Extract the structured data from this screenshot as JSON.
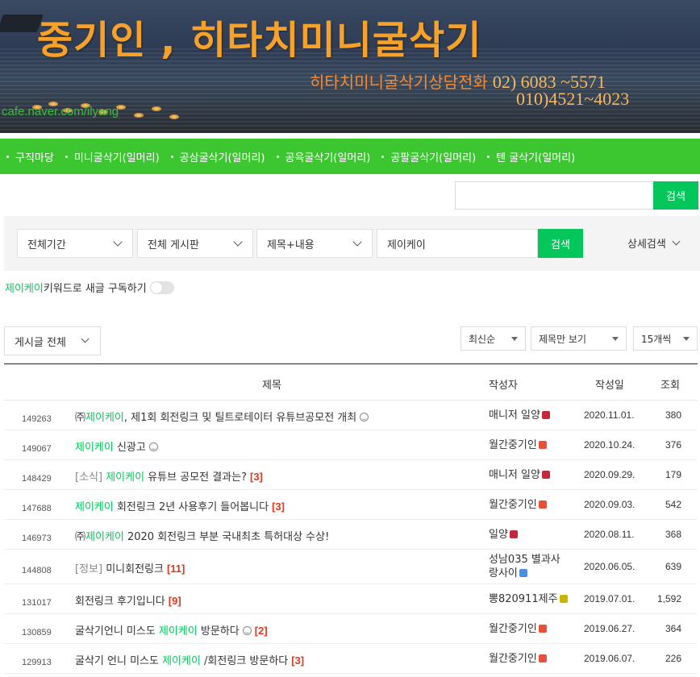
{
  "banner": {
    "title": "중기인 , 히타치미니굴삭기",
    "phone_label": "히타치미니굴삭기상담전화",
    "phone1": "02) 6083 ~5571",
    "phone2": "010)4521~4023",
    "url": "cafe.naver.com/ilyang"
  },
  "nav": {
    "items": [
      "구직마당",
      "미니굴삭기(일머리)",
      "공삼굴삭기(일머리)",
      "공육굴삭기(일머리)",
      "공팔굴삭기(일머리)",
      "텐 굴삭기(일머리)"
    ]
  },
  "top_search": {
    "value": "",
    "button": "검색"
  },
  "filter": {
    "period": "전체기간",
    "board": "전체 게시판",
    "scope": "제목+내용",
    "keyword": "제이케이",
    "search_button": "검색",
    "detail": "상세검색"
  },
  "subscribe": {
    "keyword": "제이케이",
    "text": " 키워드로 새글 구독하기"
  },
  "list_controls": {
    "all_posts": "게시글 전체",
    "sort": "최신순",
    "view": "제목만 보기",
    "per_page": "15개씩"
  },
  "table": {
    "headers": {
      "title": "제목",
      "author": "작성자",
      "date": "작성일",
      "views": "조회"
    },
    "rows": [
      {
        "num": "149263",
        "pre": "",
        "before": "㈜",
        "hl": "제이케이",
        "after": ", 제1회 회전링크 및 틸트로테이터 유튜브공모전 개최",
        "emo": true,
        "comments": "",
        "author": "매니저 일양",
        "author2": "",
        "badge": "m",
        "date": "2020.11.01.",
        "views": "380"
      },
      {
        "num": "149067",
        "pre": "",
        "before": "",
        "hl": "제이케이",
        "after": " 신광고",
        "emo": true,
        "comments": "",
        "author": "월간중기인",
        "author2": "",
        "badge": "s",
        "date": "2020.10.24.",
        "views": "376"
      },
      {
        "num": "148429",
        "pre": "[소식] ",
        "before": "",
        "hl": "제이케이",
        "after": " 유튜브 공모전 결과는?",
        "emo": false,
        "comments": "[3]",
        "author": "매니저 일양",
        "author2": "",
        "badge": "m",
        "date": "2020.09.29.",
        "views": "179"
      },
      {
        "num": "147688",
        "pre": "",
        "before": "",
        "hl": "제이케이",
        "after": " 회전링크 2년 사용후기 들어봅니다",
        "emo": false,
        "comments": "[3]",
        "author": "월간중기인",
        "author2": "",
        "badge": "s",
        "date": "2020.09.03.",
        "views": "542"
      },
      {
        "num": "146973",
        "pre": "",
        "before": "㈜",
        "hl": "제이케이",
        "after": " 2020 회전링크 부분 국내최초 특허대상 수상!",
        "emo": false,
        "comments": "",
        "author": "일양",
        "author2": "",
        "badge": "m",
        "date": "2020.08.11.",
        "views": "368"
      },
      {
        "num": "144808",
        "pre": "[정보] ",
        "before": "미니회전링크",
        "hl": "",
        "after": "",
        "emo": false,
        "comments": "[11]",
        "author": "성남035 별과사",
        "author2": "랑사이",
        "badge": "b",
        "date": "2020.06.05.",
        "views": "639"
      },
      {
        "num": "131017",
        "pre": "",
        "before": "회전링크 후기입니다",
        "hl": "",
        "after": "",
        "emo": false,
        "comments": "[9]",
        "author": "뽕820911제주",
        "author2": "",
        "badge": "y",
        "date": "2019.07.01.",
        "views": "1,592"
      },
      {
        "num": "130859",
        "pre": "",
        "before": "굴삭기언니 미스도 ",
        "hl": "제이케이",
        "after": " 방문하다",
        "emo": true,
        "comments": "[2]",
        "author": "월간중기인",
        "author2": "",
        "badge": "s",
        "date": "2019.06.27.",
        "views": "364"
      },
      {
        "num": "129913",
        "pre": "",
        "before": "굴삭기 언니 미스도 ",
        "hl": "제이케이",
        "after": " /회전링크 방문하다",
        "emo": false,
        "comments": "[3]",
        "author": "월간중기인",
        "author2": "",
        "badge": "s",
        "date": "2019.06.07.",
        "views": "226"
      }
    ]
  }
}
